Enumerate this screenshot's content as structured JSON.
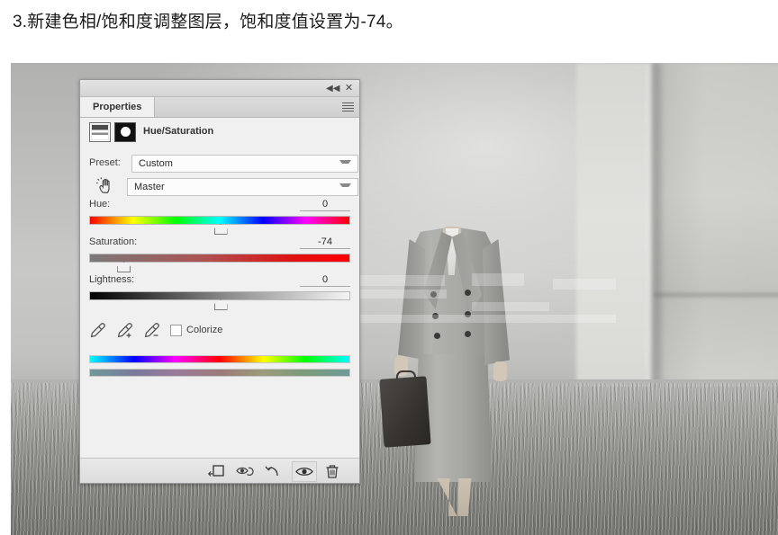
{
  "caption": "3.新建色相/饱和度调整图层，饱和度值设置为-74。",
  "panel": {
    "tab_label": "Properties",
    "collapse_label": "◀◀",
    "close_label": "✕",
    "menu_icon": "hamburger-menu-icon",
    "adjustment_title": "Hue/Saturation",
    "adjustment_thumb_icon": "hue-saturation-adjustment-icon",
    "mask_thumb_icon": "layer-mask-thumbnail-icon",
    "preset": {
      "label": "Preset:",
      "value": "Custom"
    },
    "channel": {
      "icon": "on-image-adjustment-hand-icon",
      "value": "Master"
    },
    "sliders": [
      {
        "label": "Hue:",
        "value": "0",
        "position_pct": 50,
        "track": "hue"
      },
      {
        "label": "Saturation:",
        "value": "-74",
        "position_pct": 13,
        "track": "saturation"
      },
      {
        "label": "Lightness:",
        "value": "0",
        "position_pct": 50,
        "track": "lightness"
      }
    ],
    "eyedroppers": [
      {
        "icon": "eyedropper-icon"
      },
      {
        "icon": "eyedropper-add-icon"
      },
      {
        "icon": "eyedropper-subtract-icon"
      }
    ],
    "colorize": {
      "label": "Colorize",
      "checked": false
    },
    "footer_buttons": [
      {
        "icon": "clip-to-layer-icon",
        "active": false
      },
      {
        "icon": "view-previous-state-icon",
        "active": false
      },
      {
        "icon": "reset-icon",
        "active": false
      },
      {
        "icon": "toggle-visibility-icon",
        "active": true
      },
      {
        "icon": "delete-layer-icon",
        "active": false
      }
    ]
  },
  "photo": {
    "subject": "headless-figure-in-gray-suit-with-briefcase",
    "background": "blurred-concrete-pillar-and-grass-field",
    "watermark": "faint-white-watermark-overlay"
  },
  "colors": {
    "panel_bg": "#f0f0f0",
    "panel_border": "#9a9a9a",
    "text": "#2e2e2e",
    "saturation_accent": "#ff0000",
    "photo_gray": "#b9b9b7"
  }
}
